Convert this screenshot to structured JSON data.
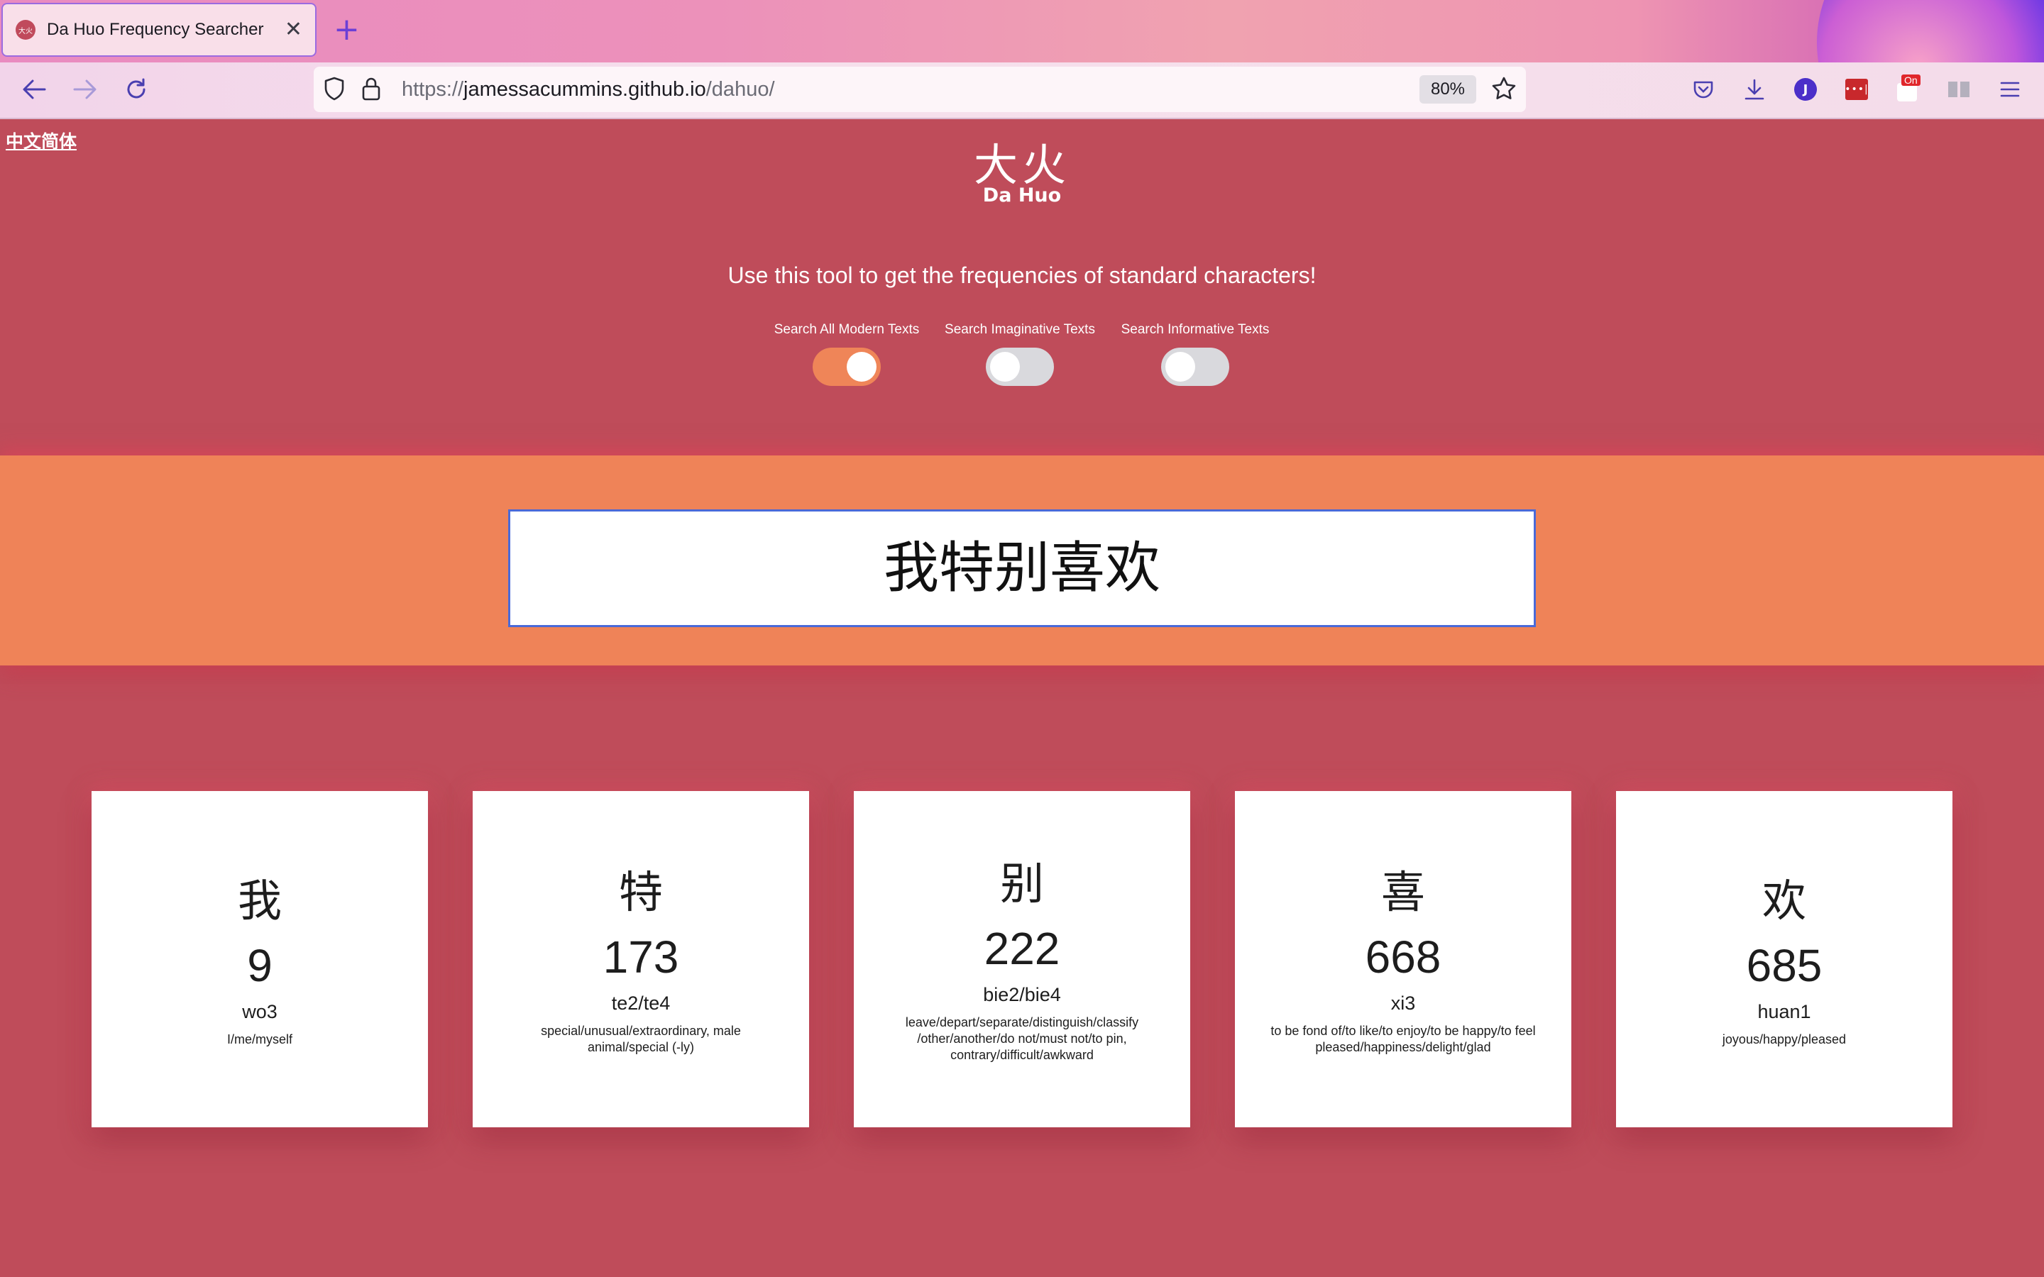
{
  "browser": {
    "tab": {
      "title": "Da Huo Frequency Searcher",
      "favicon_text": "大火"
    },
    "new_tab_icon": "plus-icon",
    "url": {
      "scheme": "https://",
      "host": "jamessacummins.github.io",
      "path": "/dahuo/"
    },
    "zoom": "80%",
    "extension_badge": "On",
    "account_initial": "J",
    "colors": {
      "accent": "#6b3fd6"
    }
  },
  "page": {
    "language_link": "中文简体",
    "logo": {
      "chinese": "大火",
      "english": "Da Huo"
    },
    "tagline": "Use this tool to get the frequencies of standard characters!",
    "toggles": [
      {
        "label": "Search All Modern Texts",
        "on": true
      },
      {
        "label": "Search Imaginative Texts",
        "on": false
      },
      {
        "label": "Search Informative Texts",
        "on": false
      }
    ],
    "search": {
      "value": "我特别喜欢"
    },
    "cards": [
      {
        "char": "我",
        "frequency": "9",
        "pinyin": "wo3",
        "meaning": "I/me/myself"
      },
      {
        "char": "特",
        "frequency": "173",
        "pinyin": "te2/te4",
        "meaning": "special/unusual/extraordinary, male animal/special (-ly)"
      },
      {
        "char": "别",
        "frequency": "222",
        "pinyin": "bie2/bie4",
        "meaning": "leave/depart/separate/distinguish/classify /other/another/do not/must not/to pin, contrary/difficult/awkward"
      },
      {
        "char": "喜",
        "frequency": "668",
        "pinyin": "xi3",
        "meaning": "to be fond of/to like/to enjoy/to be happy/to feel pleased/happiness/delight/glad"
      },
      {
        "char": "欢",
        "frequency": "685",
        "pinyin": "huan1",
        "meaning": "joyous/happy/pleased"
      }
    ],
    "colors": {
      "background": "#bf4c5a",
      "band": "#ef8358",
      "toggle_on": "#ef8558",
      "toggle_off": "#d9d9dd"
    }
  }
}
